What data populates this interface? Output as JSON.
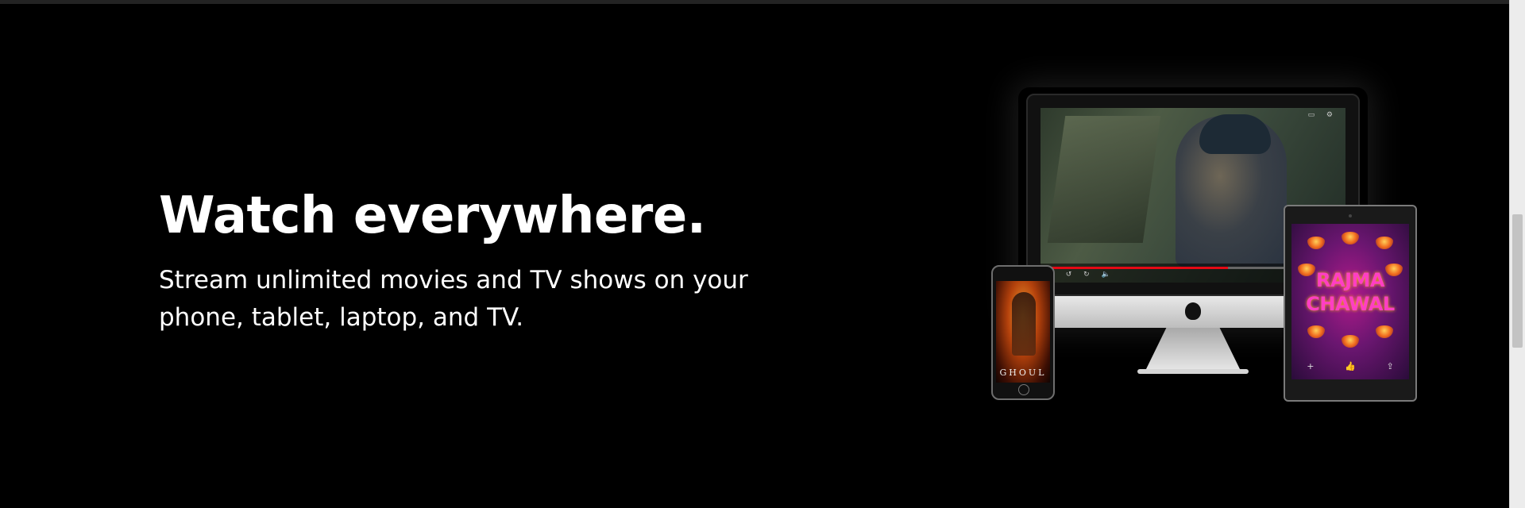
{
  "hero": {
    "headline": "Watch everywhere.",
    "subhead": "Stream unlimited movies and TV shows on your phone, tablet, laptop, and TV."
  },
  "devices": {
    "phone_title": "GHOUL",
    "tablet_title": "RAJMA CHAWAL",
    "tablet_controls": [
      "+",
      "👍",
      "⇪"
    ],
    "player_progress": 0.62
  },
  "colors": {
    "background": "#000000",
    "text": "#ffffff",
    "accent": "#e50914"
  }
}
